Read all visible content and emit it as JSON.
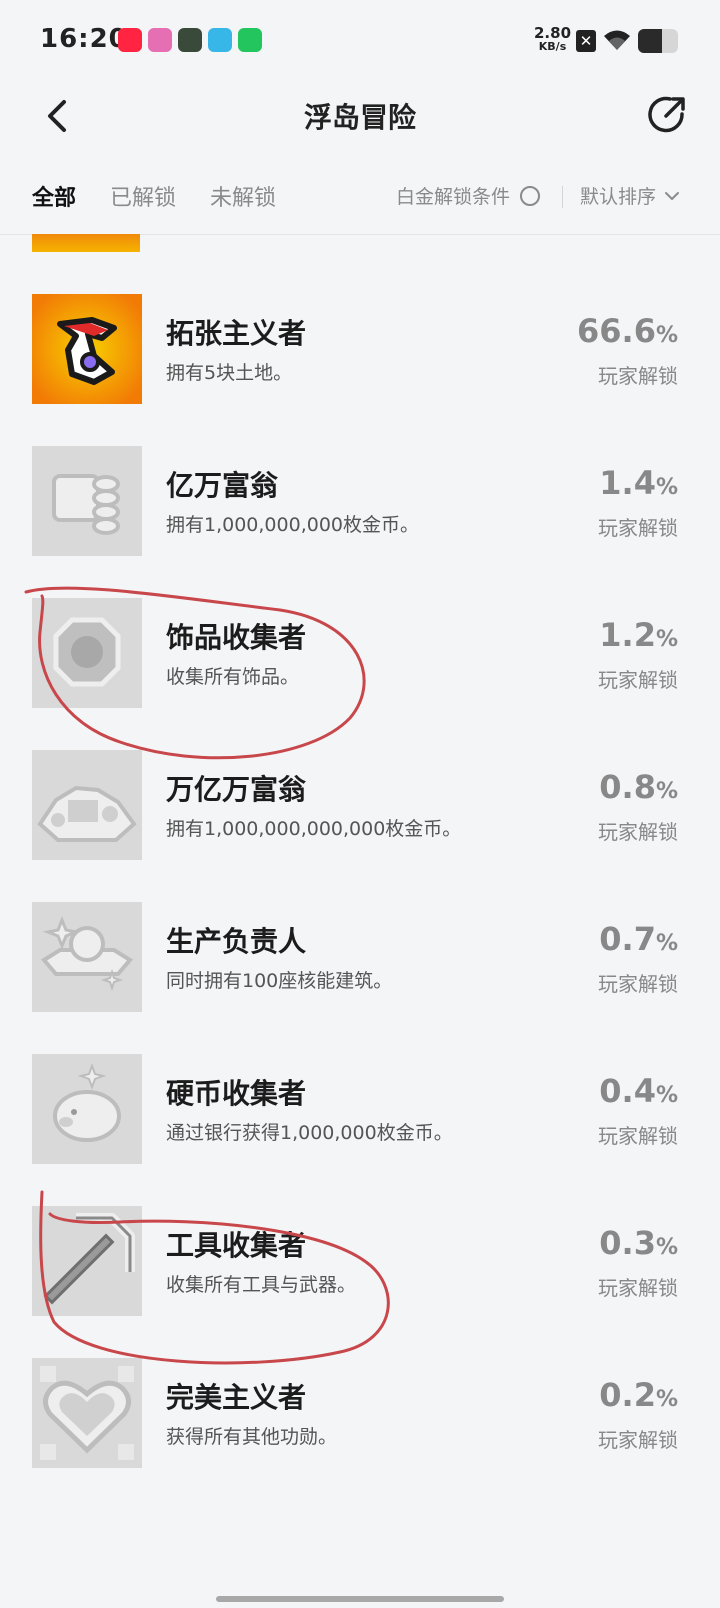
{
  "status_bar": {
    "time": "16:20",
    "net_speed_value": "2.80",
    "net_speed_unit": "KB/s",
    "app_icons": [
      {
        "name": "xiaohongshu-icon",
        "color": "#ff2442"
      },
      {
        "name": "bilibili-icon",
        "color": "#e56fb2"
      },
      {
        "name": "game-app-icon",
        "color": "#3a4a3a"
      },
      {
        "name": "hand-app-icon",
        "color": "#37b6e8"
      },
      {
        "name": "green-app-icon",
        "color": "#22c55e"
      }
    ],
    "battery_level": 0.6
  },
  "header": {
    "title": "浮岛冒险"
  },
  "tabs": {
    "all": "全部",
    "unlocked": "已解锁",
    "locked": "未解锁",
    "platinum_filter": "白金解锁条件",
    "sort": "默认排序"
  },
  "achievements": [
    {
      "name": "拓张主义者",
      "desc": "拥有5块土地。",
      "pct": "66.6",
      "pct_sign": "%",
      "label": "玩家解锁",
      "unlocked": true
    },
    {
      "name": "亿万富翁",
      "desc": "拥有1,000,000,000枚金币。",
      "pct": "1.4",
      "pct_sign": "%",
      "label": "玩家解锁",
      "unlocked": false
    },
    {
      "name": "饰品收集者",
      "desc": "收集所有饰品。",
      "pct": "1.2",
      "pct_sign": "%",
      "label": "玩家解锁",
      "unlocked": false
    },
    {
      "name": "万亿万富翁",
      "desc": "拥有1,000,000,000,000枚金币。",
      "pct": "0.8",
      "pct_sign": "%",
      "label": "玩家解锁",
      "unlocked": false
    },
    {
      "name": "生产负责人",
      "desc": "同时拥有100座核能建筑。",
      "pct": "0.7",
      "pct_sign": "%",
      "label": "玩家解锁",
      "unlocked": false
    },
    {
      "name": "硬币收集者",
      "desc": "通过银行获得1,000,000枚金币。",
      "pct": "0.4",
      "pct_sign": "%",
      "label": "玩家解锁",
      "unlocked": false
    },
    {
      "name": "工具收集者",
      "desc": "收集所有工具与武器。",
      "pct": "0.3",
      "pct_sign": "%",
      "label": "玩家解锁",
      "unlocked": false
    },
    {
      "name": "完美主义者",
      "desc": "获得所有其他功勋。",
      "pct": "0.2",
      "pct_sign": "%",
      "label": "玩家解锁",
      "unlocked": false
    }
  ],
  "colors": {
    "annotation": "#c8474b",
    "locked_badge": "#d9d9d9",
    "unlocked_badge": "#f49a0c"
  }
}
